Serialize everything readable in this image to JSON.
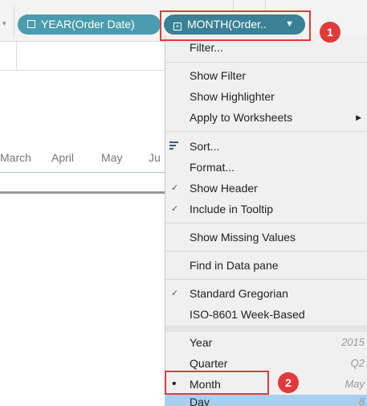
{
  "shelf": {
    "pill_year": "YEAR(Order Date)",
    "pill_month": "MONTH(Order..",
    "pill_box_symbol": "⊟",
    "pill_month_box_symbol": "⊞"
  },
  "axis": {
    "labels": [
      "March",
      "April",
      "May",
      "Ju"
    ]
  },
  "menu": {
    "filter": "Filter...",
    "show_filter": "Show Filter",
    "show_highlighter": "Show Highlighter",
    "apply_to_worksheets": "Apply to Worksheets",
    "sort": "Sort...",
    "format": "Format...",
    "show_header": "Show Header",
    "include_in_tooltip": "Include in Tooltip",
    "show_missing_values": "Show Missing Values",
    "find_in_data_pane": "Find in Data pane",
    "standard_gregorian": "Standard Gregorian",
    "iso_week_based": "ISO-8601 Week-Based",
    "year": "Year",
    "year_value": "2015",
    "quarter": "Quarter",
    "quarter_value": "Q2",
    "month": "Month",
    "month_value": "May",
    "day": "Day",
    "day_value": "8"
  },
  "annotations": {
    "badge_1": "1",
    "badge_2": "2"
  },
  "colors": {
    "pill_year": "#4a9cae",
    "pill_month": "#3a8196",
    "menu_bg": "#f0f0f0",
    "highlight": "#e03c3c",
    "day_row": "#a8cfee"
  }
}
